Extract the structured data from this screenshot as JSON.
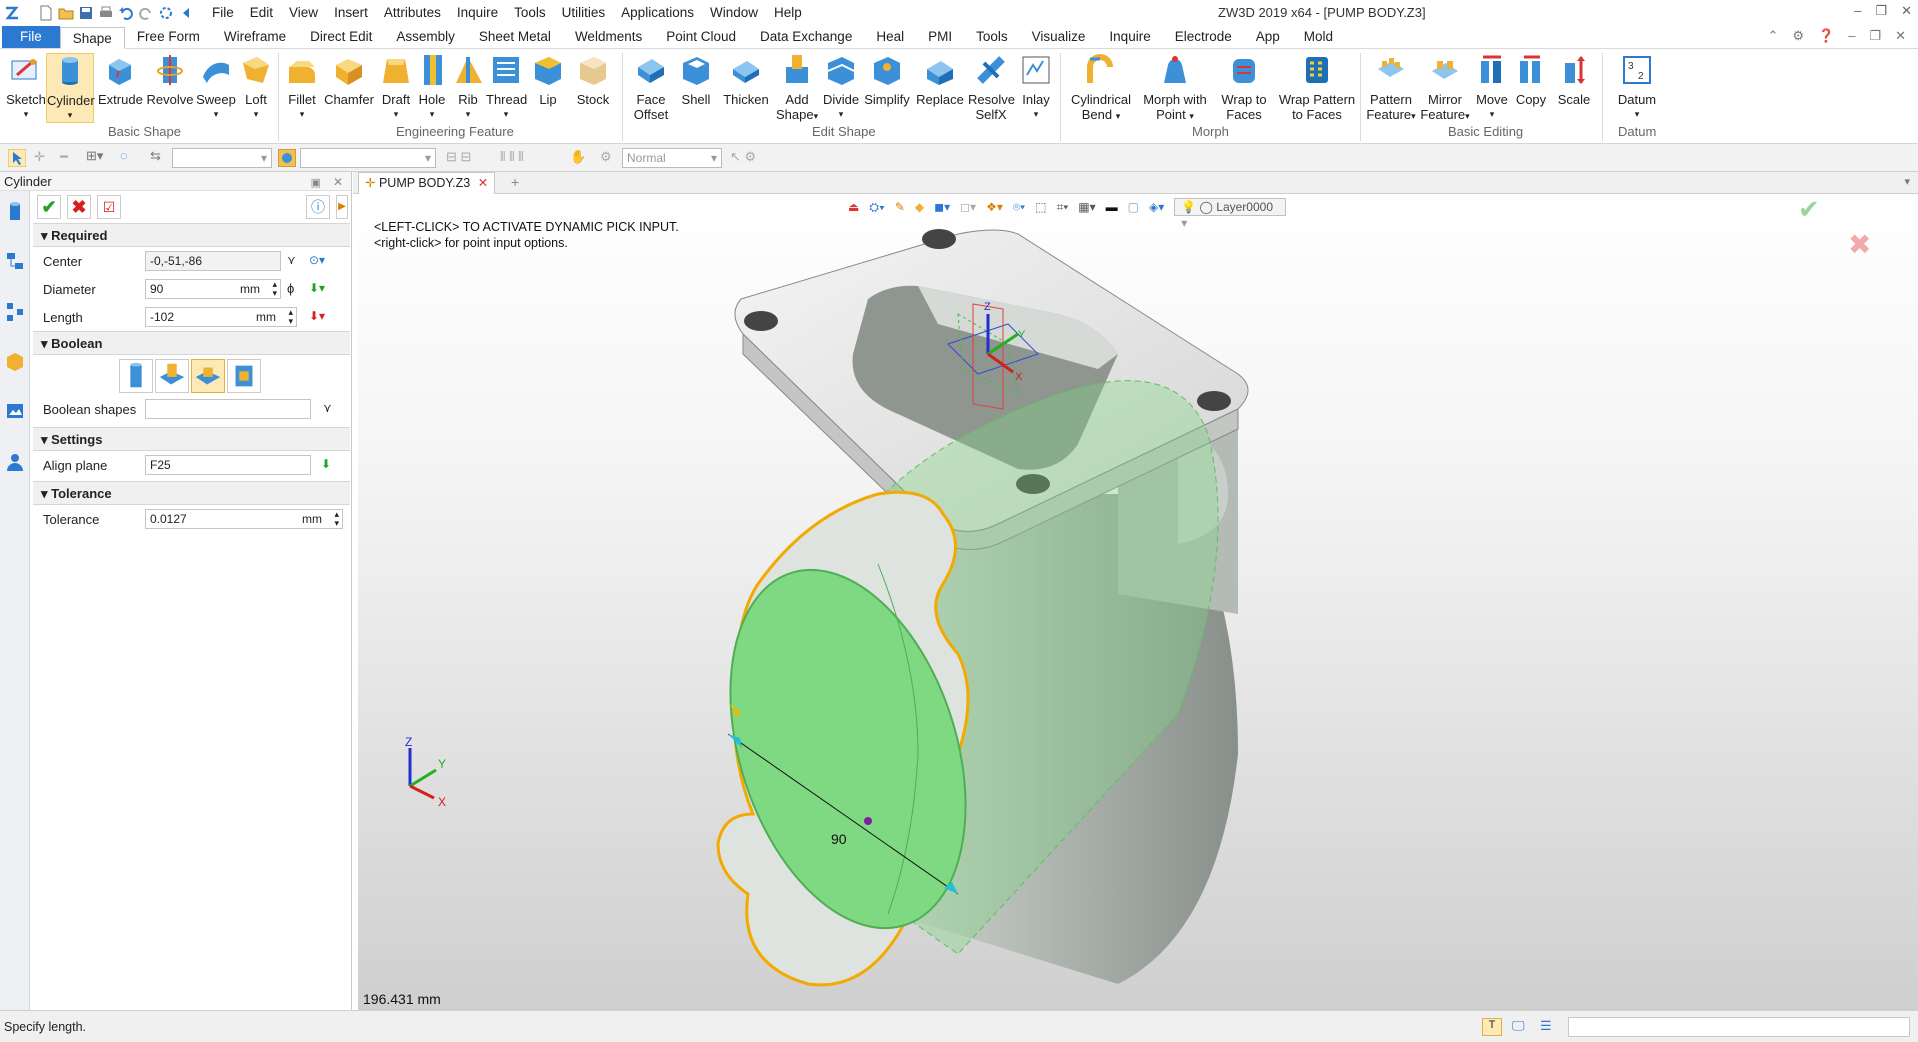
{
  "app": {
    "title": "ZW3D 2019  x64 - [PUMP BODY.Z3]"
  },
  "menu": [
    "File",
    "Edit",
    "View",
    "Insert",
    "Attributes",
    "Inquire",
    "Tools",
    "Utilities",
    "Applications",
    "Window",
    "Help"
  ],
  "ribbon_tabs": [
    "File",
    "Shape",
    "Free Form",
    "Wireframe",
    "Direct Edit",
    "Assembly",
    "Sheet Metal",
    "Weldments",
    "Point Cloud",
    "Data Exchange",
    "Heal",
    "PMI",
    "Tools",
    "Visualize",
    "Inquire",
    "Electrode",
    "App",
    "Mold"
  ],
  "ribbon": {
    "groups": {
      "basic_shape": "Basic Shape",
      "engineering_feature": "Engineering Feature",
      "edit_shape": "Edit Shape",
      "morph": "Morph",
      "basic_editing": "Basic Editing",
      "datum": "Datum"
    },
    "buttons": {
      "sketch": "Sketch",
      "cylinder": "Cylinder",
      "extrude": "Extrude",
      "revolve": "Revolve",
      "sweep": "Sweep",
      "loft": "Loft",
      "fillet": "Fillet",
      "chamfer": "Chamfer",
      "draft": "Draft",
      "hole": "Hole",
      "rib": "Rib",
      "thread": "Thread",
      "lip": "Lip",
      "stock": "Stock",
      "face_offset_1": "Face",
      "face_offset_2": "Offset",
      "shell": "Shell",
      "thicken": "Thicken",
      "add_shape_1": "Add",
      "add_shape_2": "Shape",
      "divide": "Divide",
      "simplify": "Simplify",
      "replace": "Replace",
      "resolve_1": "Resolve",
      "resolve_2": "SelfX",
      "inlay": "Inlay",
      "cyl_bend_1": "Cylindrical",
      "cyl_bend_2": "Bend",
      "morph_pt_1": "Morph with",
      "morph_pt_2": "Point",
      "wrap_faces_1": "Wrap to",
      "wrap_faces_2": "Faces",
      "wrap_pat_1": "Wrap Pattern",
      "wrap_pat_2": "to Faces",
      "pattern_1": "Pattern",
      "pattern_2": "Feature",
      "mirror_1": "Mirror",
      "mirror_2": "Feature",
      "move": "Move",
      "copy": "Copy",
      "scale": "Scale",
      "datum": "Datum"
    }
  },
  "toolbar2": {
    "filter_mode": "Normal"
  },
  "panel": {
    "title": "Cylinder",
    "sections": {
      "required": "Required",
      "boolean": "Boolean",
      "settings": "Settings",
      "tolerance": "Tolerance"
    },
    "fields": {
      "center_label": "Center",
      "center_value": "-0,-51,-86",
      "diameter_label": "Diameter",
      "diameter_value": "90",
      "diameter_unit": "mm",
      "length_label": "Length",
      "length_value": "-102",
      "length_unit": "mm",
      "boolean_shapes_label": "Boolean shapes",
      "boolean_shapes_value": "",
      "align_plane_label": "Align plane",
      "align_plane_value": "F25",
      "tolerance_label": "Tolerance",
      "tolerance_value": "0.0127",
      "tolerance_unit": "mm"
    }
  },
  "doc_tab": {
    "name": "PUMP BODY.Z3"
  },
  "viewport": {
    "layer": "Layer0000",
    "hint_line1": "<LEFT-CLICK> TO ACTIVATE DYNAMIC PICK INPUT.",
    "hint_line2": "<right-click> for point input options.",
    "dimension_label": "90",
    "measure_readout": "196.431 mm",
    "triad": {
      "z": "Z",
      "y": "Y",
      "x": "X"
    }
  },
  "status": {
    "prompt": "Specify length."
  },
  "colors": {
    "accent": "#2b79d0",
    "preview_green": "#7fd882",
    "highlight_orange": "#f2a900",
    "body_gray": "#c8cdc8"
  }
}
